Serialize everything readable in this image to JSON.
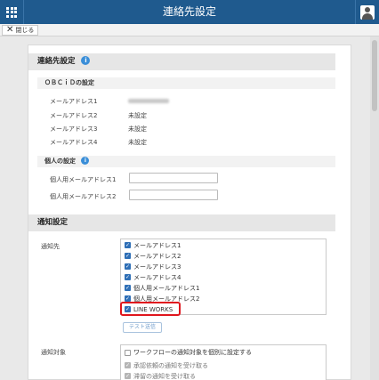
{
  "header": {
    "title": "連絡先設定"
  },
  "toolbar": {
    "close_label": "閉じる"
  },
  "contact_section": {
    "title": "連絡先設定",
    "obcid": {
      "title": "ＯＢＣｉＤの設定",
      "rows": [
        {
          "label": "メールアドレス1",
          "value": ""
        },
        {
          "label": "メールアドレス2",
          "value": "未設定"
        },
        {
          "label": "メールアドレス3",
          "value": "未設定"
        },
        {
          "label": "メールアドレス4",
          "value": "未設定"
        }
      ]
    },
    "personal": {
      "title": "個人の設定",
      "rows": [
        {
          "label": "個人用メールアドレス1",
          "value": ""
        },
        {
          "label": "個人用メールアドレス2",
          "value": ""
        }
      ]
    }
  },
  "notify_section": {
    "title": "通知設定",
    "destination_label": "通知先",
    "destinations": [
      {
        "label": "メールアドレス1",
        "checked": true
      },
      {
        "label": "メールアドレス2",
        "checked": true
      },
      {
        "label": "メールアドレス3",
        "checked": true
      },
      {
        "label": "メールアドレス4",
        "checked": true
      },
      {
        "label": "個人用メールアドレス1",
        "checked": true
      },
      {
        "label": "個人用メールアドレス2",
        "checked": true
      },
      {
        "label": "LINE WORKS",
        "checked": true
      }
    ],
    "test_button": "テスト送信",
    "target_label": "通知対象",
    "workflow_option": "ワークフローの通知対象を個別に設定する",
    "sub_options": [
      {
        "label": "承認依頼の通知を受け取る",
        "checked": true
      },
      {
        "label": "滞留の通知を受け取る",
        "checked": true
      }
    ]
  },
  "colors": {
    "header": "#1f5a8e",
    "highlight": "#e0161d",
    "checkbox": "#2f6fb6",
    "info": "#3a8ed8"
  }
}
